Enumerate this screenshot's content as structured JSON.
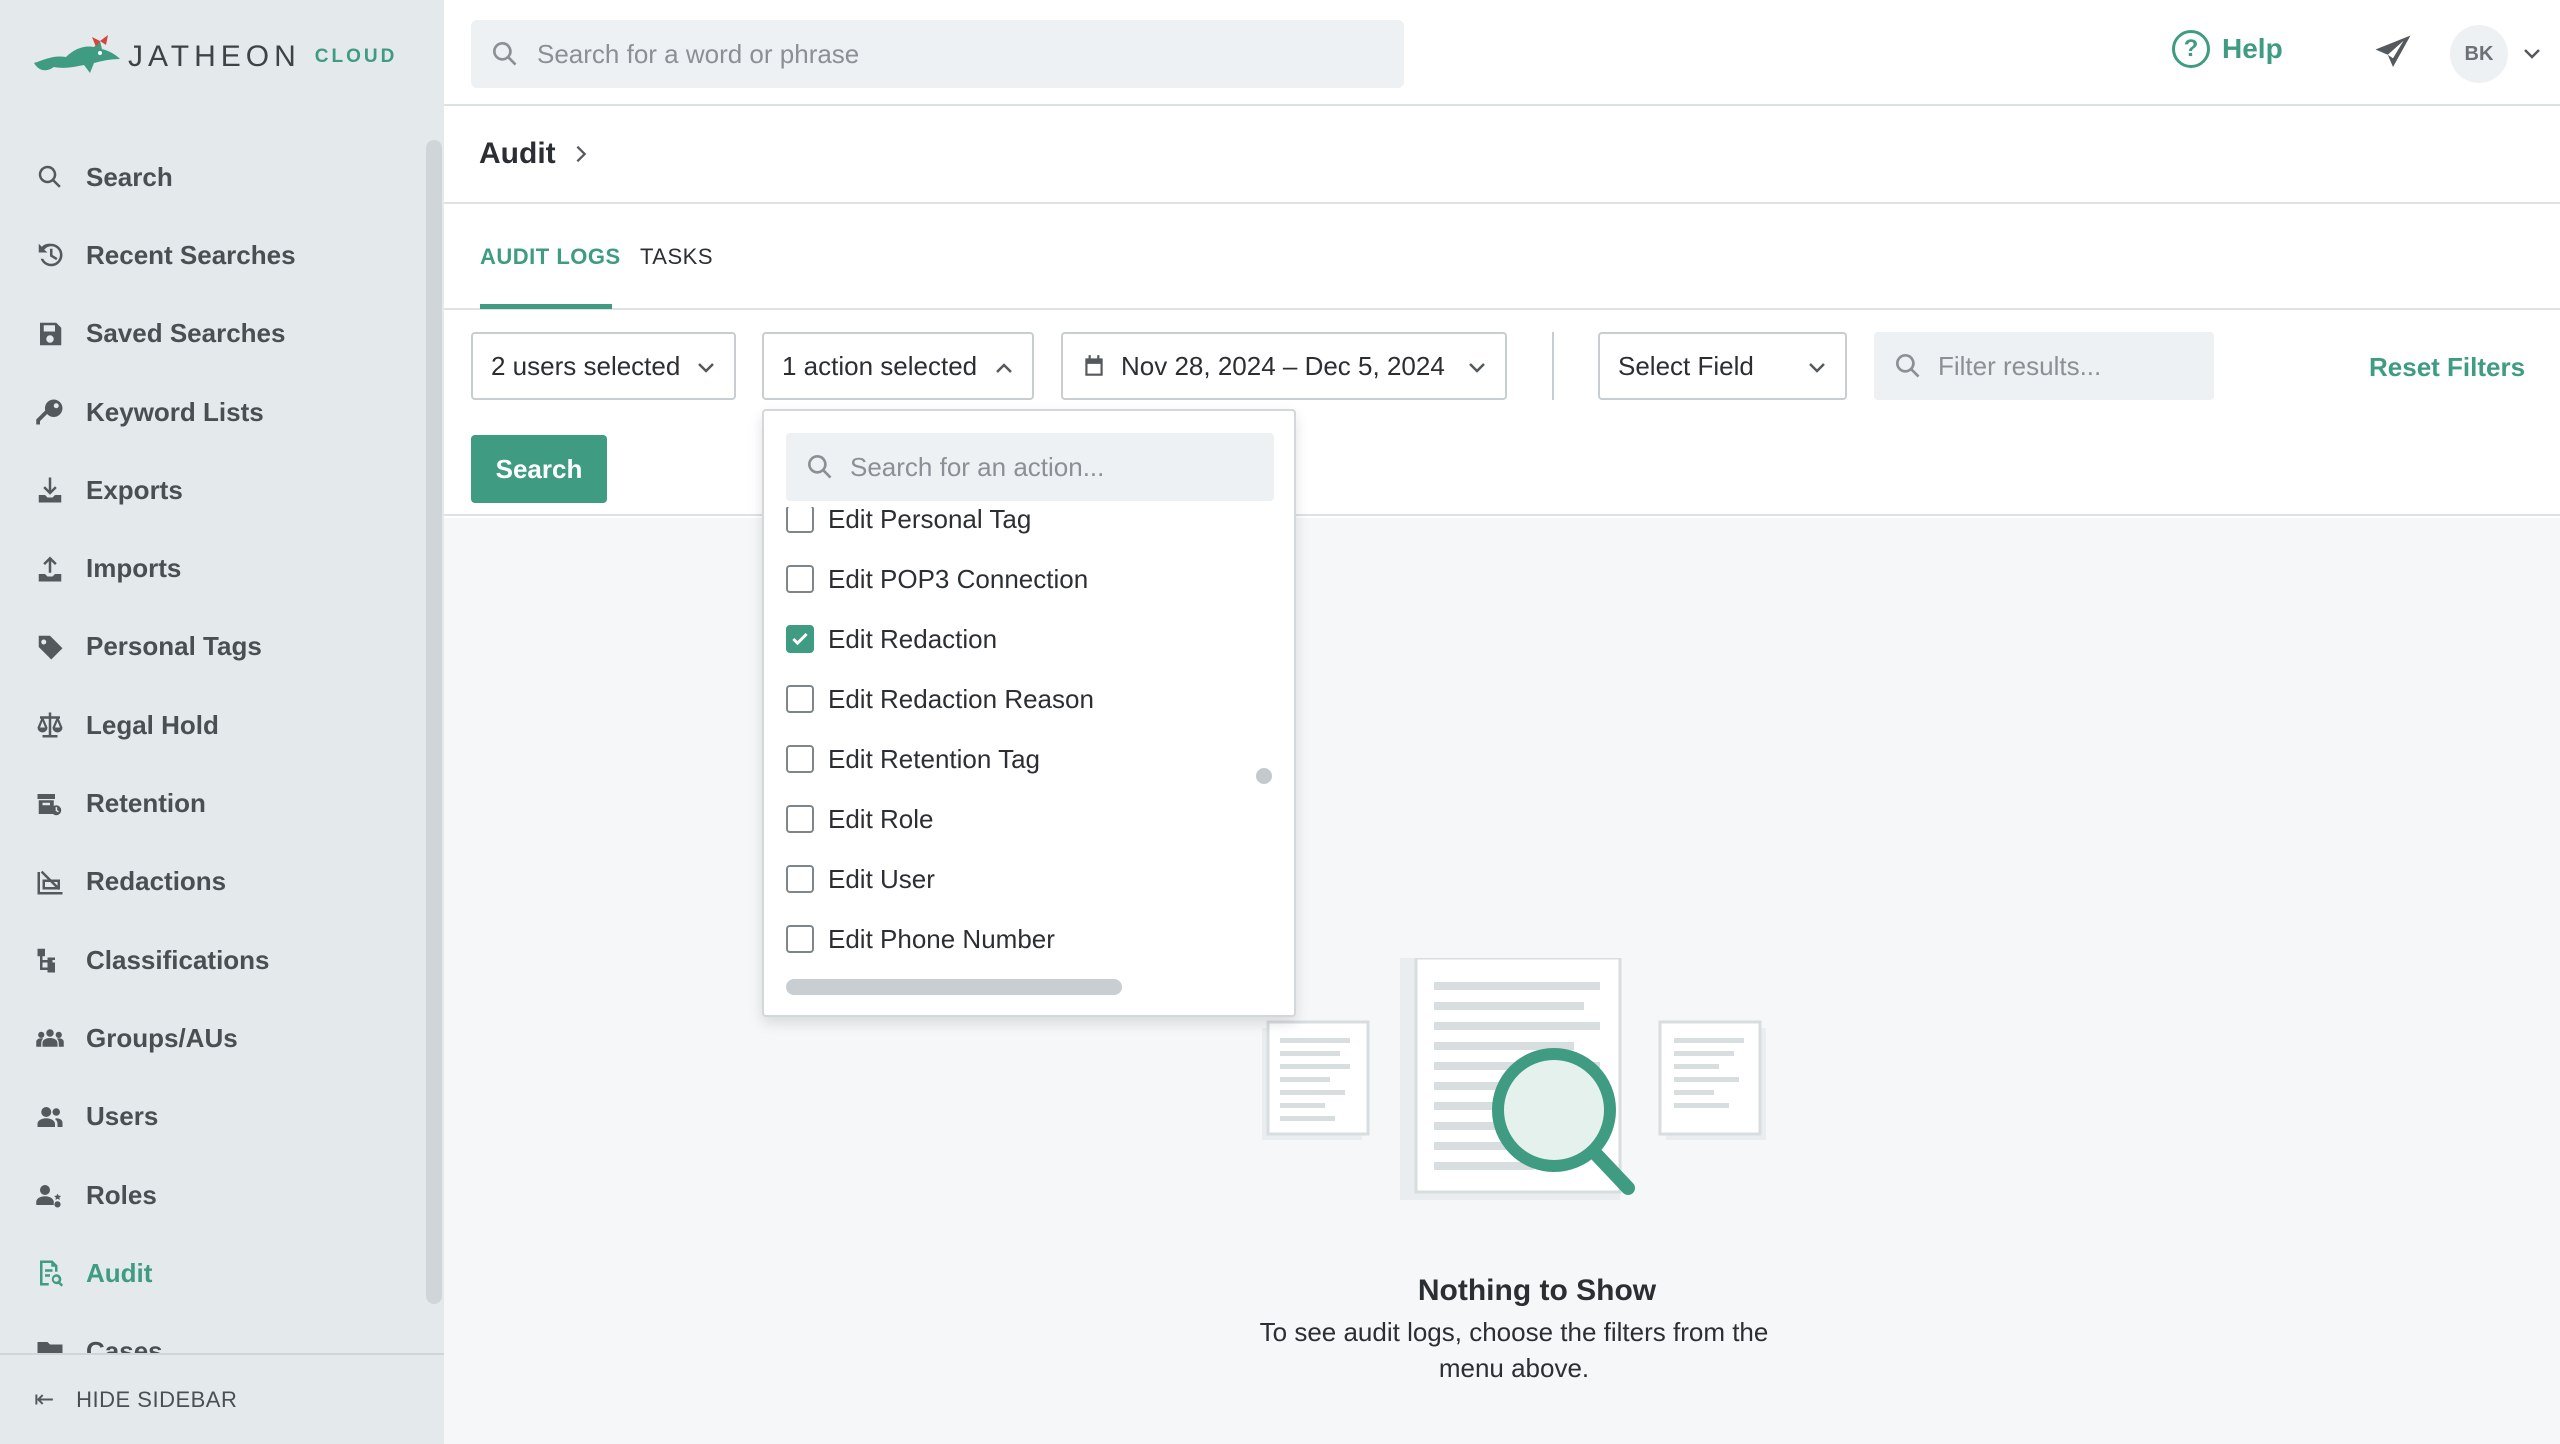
{
  "brand": {
    "name": "JATHEON",
    "product": "CLOUD"
  },
  "sidebar": {
    "items": [
      {
        "label": "Search",
        "icon": "search-icon"
      },
      {
        "label": "Recent Searches",
        "icon": "history-icon"
      },
      {
        "label": "Saved Searches",
        "icon": "save-icon"
      },
      {
        "label": "Keyword Lists",
        "icon": "key-icon"
      },
      {
        "label": "Exports",
        "icon": "download-icon"
      },
      {
        "label": "Imports",
        "icon": "upload-icon"
      },
      {
        "label": "Personal Tags",
        "icon": "tag-icon"
      },
      {
        "label": "Legal Hold",
        "icon": "scale-icon"
      },
      {
        "label": "Retention",
        "icon": "archive-icon"
      },
      {
        "label": "Redactions",
        "icon": "redaction-icon"
      },
      {
        "label": "Classifications",
        "icon": "hierarchy-icon"
      },
      {
        "label": "Groups/AUs",
        "icon": "groups-icon"
      },
      {
        "label": "Users",
        "icon": "users-icon"
      },
      {
        "label": "Roles",
        "icon": "roles-icon"
      },
      {
        "label": "Audit",
        "icon": "audit-icon",
        "active": true
      },
      {
        "label": "Cases",
        "icon": "folder-icon"
      }
    ],
    "hide_label": "HIDE SIDEBAR"
  },
  "topbar": {
    "search_placeholder": "Search for a word or phrase",
    "help_label": "Help",
    "avatar_initials": "BK"
  },
  "breadcrumb": {
    "title": "Audit"
  },
  "tabs": [
    {
      "label": "AUDIT LOGS",
      "active": true
    },
    {
      "label": "TASKS",
      "active": false
    }
  ],
  "filters": {
    "users": "2 users selected",
    "actions": "1 action selected",
    "date_range": "Nov 28, 2024 – Dec 5, 2024",
    "field": "Select Field",
    "filter_placeholder": "Filter results...",
    "reset_label": "Reset Filters",
    "search_label": "Search"
  },
  "action_dropdown": {
    "search_placeholder": "Search for an action...",
    "items": [
      {
        "label": "Edit Personal Tag",
        "checked": false
      },
      {
        "label": "Edit POP3 Connection",
        "checked": false
      },
      {
        "label": "Edit Redaction",
        "checked": true
      },
      {
        "label": "Edit Redaction Reason",
        "checked": false
      },
      {
        "label": "Edit Retention Tag",
        "checked": false
      },
      {
        "label": "Edit Role",
        "checked": false
      },
      {
        "label": "Edit User",
        "checked": false
      },
      {
        "label": "Edit Phone Number",
        "checked": false
      }
    ]
  },
  "empty_state": {
    "title": "Nothing to Show",
    "description": "To see audit logs, choose the filters from the menu above."
  },
  "colors": {
    "accent": "#3f9c82",
    "sidebar_bg": "#e4e9ec",
    "text": "#2b2f33"
  }
}
